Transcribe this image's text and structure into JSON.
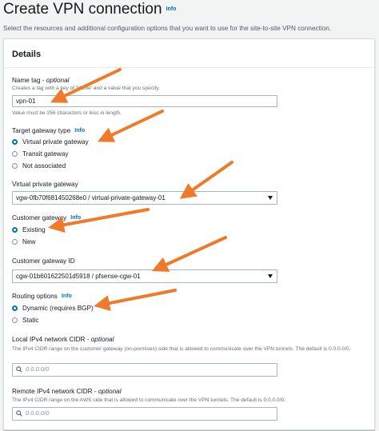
{
  "page": {
    "title": "Create VPN connection",
    "info": "Info",
    "description": "Select the resources and additional configuration options that you want to use for the site-to-site VPN connection."
  },
  "details": {
    "title": "Details",
    "name_tag": {
      "label": "Name tag",
      "optional": "- optional",
      "hint": "Creates a tag with a key of 'Name' and a value that you specify.",
      "value": "vpn-01",
      "constraint": "Value must be 256 characters or less in length."
    },
    "target_gateway_type": {
      "label": "Target gateway type",
      "info": "Info",
      "options": [
        {
          "label": "Virtual private gateway",
          "checked": true
        },
        {
          "label": "Transit gateway",
          "checked": false
        },
        {
          "label": "Not associated",
          "checked": false
        }
      ]
    },
    "virtual_private_gateway": {
      "label": "Virtual private gateway",
      "value": "vgw-0fb70f681450268e0 / virtual-private-gateway-01"
    },
    "customer_gateway": {
      "label": "Customer gateway",
      "info": "Info",
      "options": [
        {
          "label": "Existing",
          "checked": true
        },
        {
          "label": "New",
          "checked": false
        }
      ]
    },
    "customer_gateway_id": {
      "label": "Customer gateway ID",
      "value": "cgw-01b601622501d5918 / pfsense-cgw-01"
    },
    "routing_options": {
      "label": "Routing options",
      "info": "Info",
      "options": [
        {
          "label": "Dynamic (requires BGP)",
          "checked": true
        },
        {
          "label": "Static",
          "checked": false
        }
      ]
    },
    "local_cidr": {
      "label": "Local IPv4 network CIDR",
      "optional": "- optional",
      "description": "The IPv4 CIDR range on the customer gateway (on-premises) side that is allowed to communicate over the VPN tunnels. The default is 0.0.0.0/0.",
      "placeholder": "0.0.0.0/0"
    },
    "remote_cidr": {
      "label": "Remote IPv4 network CIDR",
      "optional": "- optional",
      "description": "The IPv4 CIDR range on the AWS side that is allowed to communicate over the VPN tunnels. The default is 0.0.0.0/0.",
      "placeholder": "0.0.0.0/0"
    }
  },
  "colors": {
    "arrow": "#ee7a2a",
    "link": "#0073bb",
    "radio_selected": "#0073bb"
  },
  "icons": {
    "search": "search-icon",
    "dropdown": "caret-down-icon",
    "annotation": "orange-arrow-icon"
  }
}
